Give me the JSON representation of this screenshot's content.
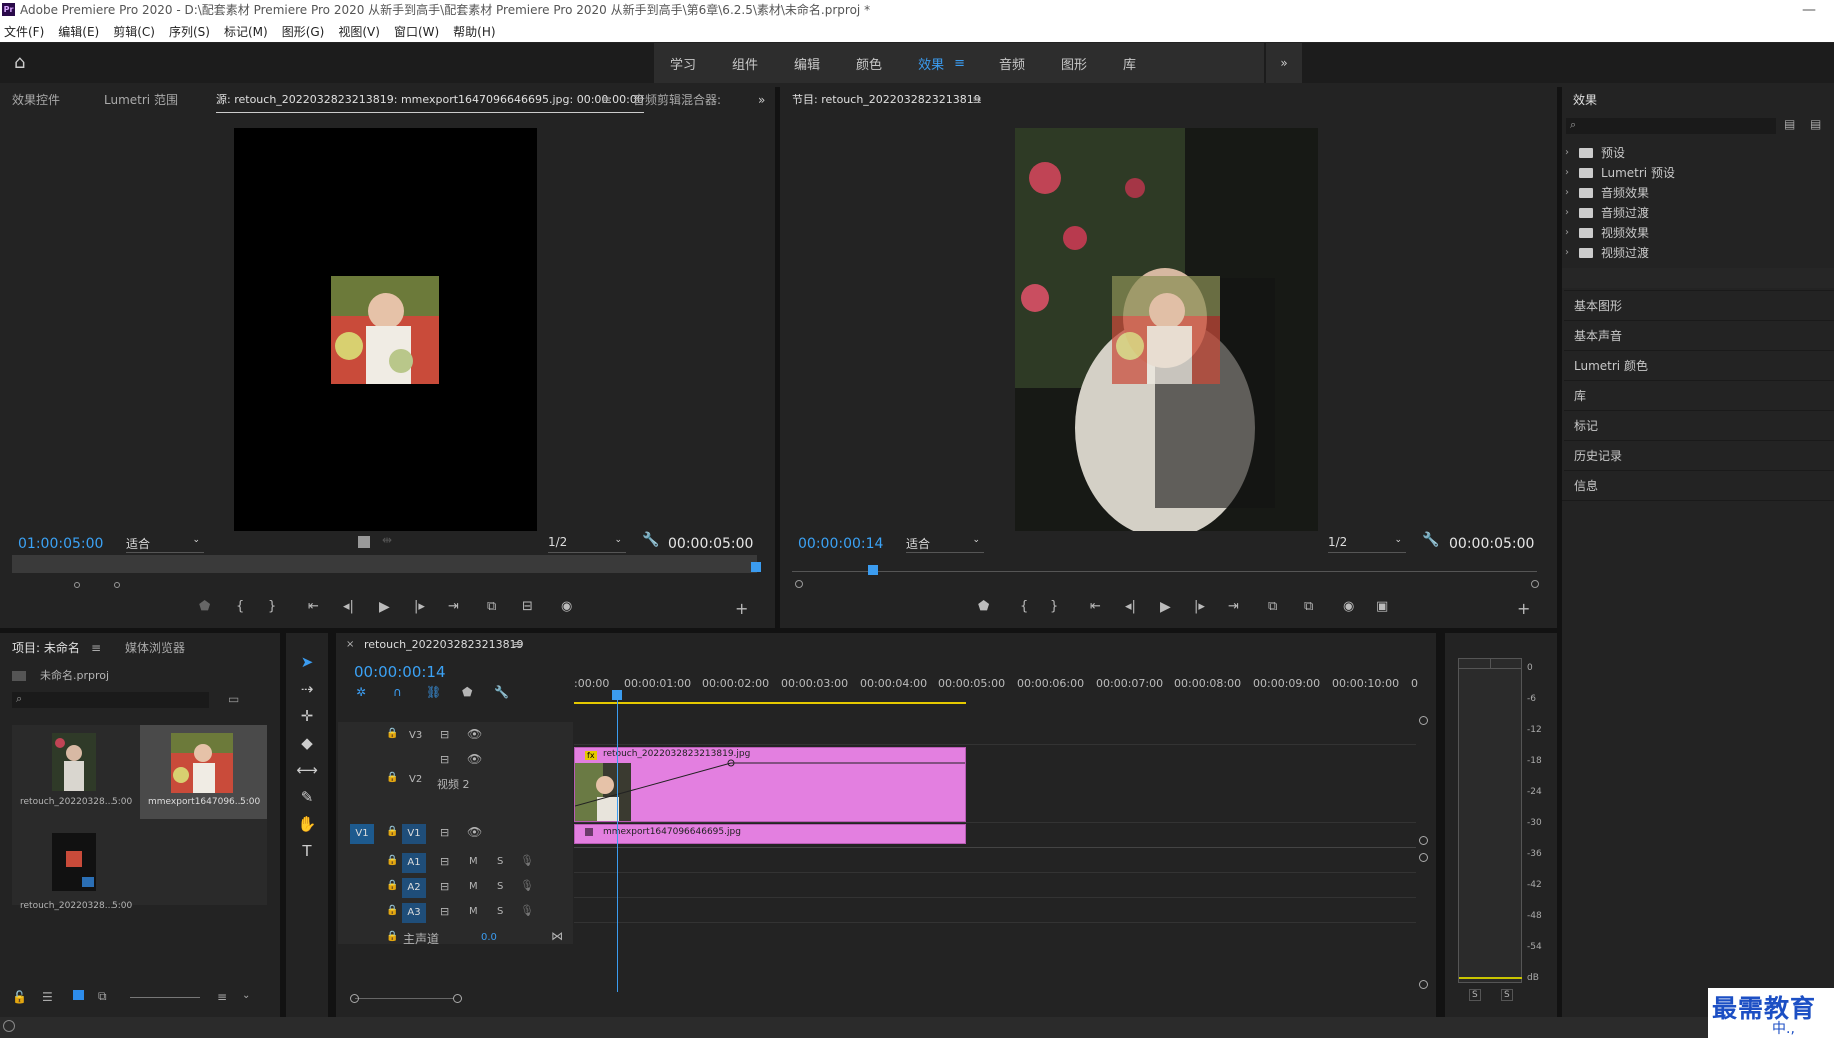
{
  "titlebar": {
    "app_icon": "Pr",
    "title": "Adobe Premiere Pro 2020 - D:\\配套素材 Premiere Pro 2020 从新手到高手\\配套素材 Premiere Pro 2020 从新手到高手\\第6章\\6.2.5\\素材\\未命名.prproj *",
    "minimize": "—"
  },
  "menu": [
    "文件(F)",
    "编辑(E)",
    "剪辑(C)",
    "序列(S)",
    "标记(M)",
    "图形(G)",
    "视图(V)",
    "窗口(W)",
    "帮助(H)"
  ],
  "workspace": {
    "tabs": [
      "学习",
      "组件",
      "编辑",
      "颜色",
      "效果",
      "音频",
      "图形",
      "库"
    ],
    "active": "效果",
    "overflow": "»",
    "menu_icon": "≡"
  },
  "source": {
    "tabs": [
      "效果控件",
      "Lumetri 范围",
      "源: retouch_2022032823213819: mmexport1647096646695.jpg: 00:00:00:00",
      "音频剪辑混合器:"
    ],
    "timecode": "01:00:05:00",
    "fit": "适合",
    "res": "1/2",
    "duration": "00:00:05:00",
    "overflow": "»",
    "menu_icon": "≡"
  },
  "program": {
    "title": "节目: retouch_2022032823213819",
    "timecode": "00:00:00:14",
    "fit": "适合",
    "res": "1/2",
    "duration": "00:00:05:00",
    "menu_icon": "≡"
  },
  "effects": {
    "title": "效果",
    "items": [
      "预设",
      "Lumetri 预设",
      "音频效果",
      "音频过渡",
      "视频效果",
      "视频过渡"
    ],
    "sections": [
      "基本图形",
      "基本声音",
      "Lumetri 颜色",
      "库",
      "标记",
      "历史记录",
      "信息"
    ]
  },
  "project": {
    "tabs": [
      "项目: 未命名",
      "媒体浏览器"
    ],
    "file": "未命名.prproj",
    "items": [
      {
        "name": "retouch_20220328...",
        "dur": "5:00"
      },
      {
        "name": "mmexport1647096...",
        "dur": "5:00"
      },
      {
        "name": "retouch_20220328...",
        "dur": "5:00"
      }
    ],
    "menu_icon": "≡"
  },
  "timeline": {
    "seq": "retouch_2022032823213819",
    "timecode": "00:00:00:14",
    "ruler": [
      ":00:00",
      "00:00:01:00",
      "00:00:02:00",
      "00:00:03:00",
      "00:00:04:00",
      "00:00:05:00",
      "00:00:06:00",
      "00:00:07:00",
      "00:00:08:00",
      "00:00:09:00",
      "00:00:10:00",
      "0"
    ],
    "tracks": {
      "v3": "V3",
      "v2": "V2",
      "v2name": "视频 2",
      "v1": "V1",
      "v1src": "V1",
      "a1": "A1",
      "a2": "A2",
      "a3": "A3",
      "m": "M",
      "s": "S",
      "master": "主声道",
      "master_val": "0.0"
    },
    "clip1": "retouch_2022032823213819.jpg",
    "clip1_fx": "fx",
    "clip2": "mmexport1647096646695.jpg",
    "menu_icon": "≡",
    "close": "×"
  },
  "meter": {
    "labels": [
      "0",
      "-6",
      "-12",
      "-18",
      "-24",
      "-30",
      "-36",
      "-42",
      "-48",
      "-54",
      "dB"
    ],
    "solo": [
      "S",
      "S"
    ]
  },
  "watermark": {
    "line1": "最需教育",
    "line2": "中.,"
  }
}
